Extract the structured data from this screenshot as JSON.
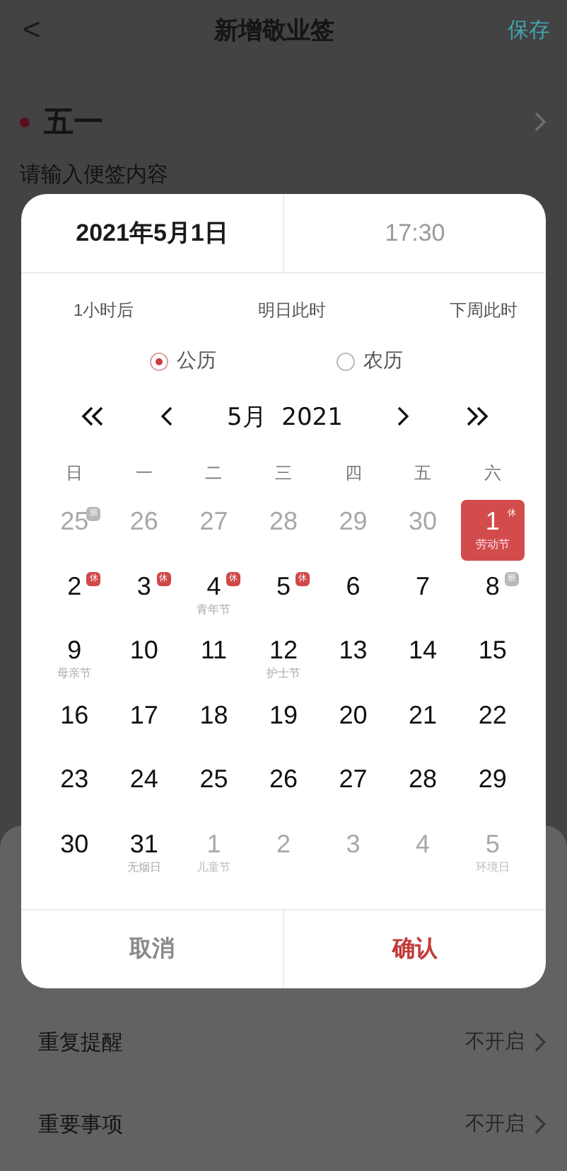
{
  "header": {
    "back": "<",
    "title": "新增敬业签",
    "save": "保存"
  },
  "note": {
    "title": "五一",
    "placeholder": "请输入便签内容"
  },
  "settings": [
    {
      "label": "重复提醒",
      "value": "不开启"
    },
    {
      "label": "重要事项",
      "value": "不开启"
    }
  ],
  "picker": {
    "date": "2021年5月1日",
    "time": "17:30",
    "date_tab_selected": true,
    "quick": [
      "1小时后",
      "明日此时",
      "下周此时"
    ],
    "calendars": [
      {
        "label": "公历",
        "selected": true
      },
      {
        "label": "农历",
        "selected": false
      }
    ],
    "month": "5月  2021",
    "weekdays": [
      "日",
      "一",
      "二",
      "三",
      "四",
      "五",
      "六"
    ],
    "days": [
      {
        "day": "25",
        "muted": true,
        "selected": false,
        "badge": {
          "kind": "work",
          "text": "班"
        }
      },
      {
        "day": "26",
        "muted": true,
        "selected": false
      },
      {
        "day": "27",
        "muted": true,
        "selected": false
      },
      {
        "day": "28",
        "muted": true,
        "selected": false
      },
      {
        "day": "29",
        "muted": true,
        "selected": false
      },
      {
        "day": "30",
        "muted": true,
        "selected": false
      },
      {
        "day": "1",
        "muted": false,
        "selected": true,
        "sub": "劳动节",
        "badge": {
          "kind": "rest",
          "text": "休"
        }
      },
      {
        "day": "2",
        "muted": false,
        "selected": false,
        "badge": {
          "kind": "rest",
          "text": "休"
        }
      },
      {
        "day": "3",
        "muted": false,
        "selected": false,
        "badge": {
          "kind": "rest",
          "text": "休"
        }
      },
      {
        "day": "4",
        "muted": false,
        "selected": false,
        "sub": "青年节",
        "badge": {
          "kind": "rest",
          "text": "休"
        }
      },
      {
        "day": "5",
        "muted": false,
        "selected": false,
        "badge": {
          "kind": "rest",
          "text": "休"
        }
      },
      {
        "day": "6",
        "muted": false,
        "selected": false
      },
      {
        "day": "7",
        "muted": false,
        "selected": false
      },
      {
        "day": "8",
        "muted": false,
        "selected": false,
        "badge": {
          "kind": "work",
          "text": "班"
        }
      },
      {
        "day": "9",
        "muted": false,
        "selected": false,
        "sub": "母亲节"
      },
      {
        "day": "10",
        "muted": false,
        "selected": false
      },
      {
        "day": "11",
        "muted": false,
        "selected": false
      },
      {
        "day": "12",
        "muted": false,
        "selected": false,
        "sub": "护士节"
      },
      {
        "day": "13",
        "muted": false,
        "selected": false
      },
      {
        "day": "14",
        "muted": false,
        "selected": false
      },
      {
        "day": "15",
        "muted": false,
        "selected": false
      },
      {
        "day": "16",
        "muted": false,
        "selected": false
      },
      {
        "day": "17",
        "muted": false,
        "selected": false
      },
      {
        "day": "18",
        "muted": false,
        "selected": false
      },
      {
        "day": "19",
        "muted": false,
        "selected": false
      },
      {
        "day": "20",
        "muted": false,
        "selected": false
      },
      {
        "day": "21",
        "muted": false,
        "selected": false
      },
      {
        "day": "22",
        "muted": false,
        "selected": false
      },
      {
        "day": "23",
        "muted": false,
        "selected": false
      },
      {
        "day": "24",
        "muted": false,
        "selected": false
      },
      {
        "day": "25",
        "muted": false,
        "selected": false
      },
      {
        "day": "26",
        "muted": false,
        "selected": false
      },
      {
        "day": "27",
        "muted": false,
        "selected": false
      },
      {
        "day": "28",
        "muted": false,
        "selected": false
      },
      {
        "day": "29",
        "muted": false,
        "selected": false
      },
      {
        "day": "30",
        "muted": false,
        "selected": false
      },
      {
        "day": "31",
        "muted": false,
        "selected": false,
        "sub": "无烟日"
      },
      {
        "day": "1",
        "muted": true,
        "selected": false,
        "sub": "儿童节"
      },
      {
        "day": "2",
        "muted": true,
        "selected": false
      },
      {
        "day": "3",
        "muted": true,
        "selected": false
      },
      {
        "day": "4",
        "muted": true,
        "selected": false
      },
      {
        "day": "5",
        "muted": true,
        "selected": false,
        "sub": "环境日"
      }
    ],
    "cancel": "取消",
    "confirm": "确认"
  }
}
